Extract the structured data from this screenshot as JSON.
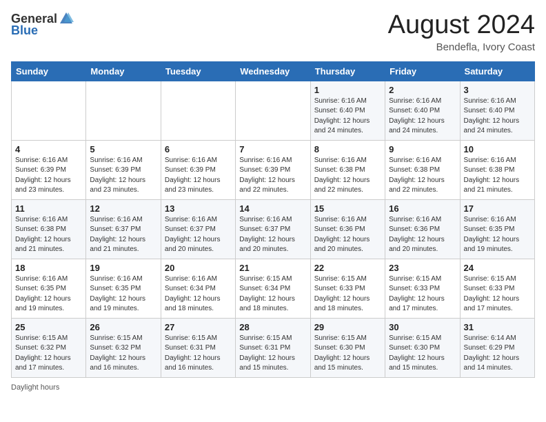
{
  "header": {
    "logo_general": "General",
    "logo_blue": "Blue",
    "month_title": "August 2024",
    "location": "Bendefla, Ivory Coast"
  },
  "footer": {
    "daylight_label": "Daylight hours"
  },
  "days_of_week": [
    "Sunday",
    "Monday",
    "Tuesday",
    "Wednesday",
    "Thursday",
    "Friday",
    "Saturday"
  ],
  "weeks": [
    {
      "days": [
        {
          "num": "",
          "detail": ""
        },
        {
          "num": "",
          "detail": ""
        },
        {
          "num": "",
          "detail": ""
        },
        {
          "num": "",
          "detail": ""
        },
        {
          "num": "1",
          "detail": "Sunrise: 6:16 AM\nSunset: 6:40 PM\nDaylight: 12 hours\nand 24 minutes."
        },
        {
          "num": "2",
          "detail": "Sunrise: 6:16 AM\nSunset: 6:40 PM\nDaylight: 12 hours\nand 24 minutes."
        },
        {
          "num": "3",
          "detail": "Sunrise: 6:16 AM\nSunset: 6:40 PM\nDaylight: 12 hours\nand 24 minutes."
        }
      ]
    },
    {
      "days": [
        {
          "num": "4",
          "detail": "Sunrise: 6:16 AM\nSunset: 6:39 PM\nDaylight: 12 hours\nand 23 minutes."
        },
        {
          "num": "5",
          "detail": "Sunrise: 6:16 AM\nSunset: 6:39 PM\nDaylight: 12 hours\nand 23 minutes."
        },
        {
          "num": "6",
          "detail": "Sunrise: 6:16 AM\nSunset: 6:39 PM\nDaylight: 12 hours\nand 23 minutes."
        },
        {
          "num": "7",
          "detail": "Sunrise: 6:16 AM\nSunset: 6:39 PM\nDaylight: 12 hours\nand 22 minutes."
        },
        {
          "num": "8",
          "detail": "Sunrise: 6:16 AM\nSunset: 6:38 PM\nDaylight: 12 hours\nand 22 minutes."
        },
        {
          "num": "9",
          "detail": "Sunrise: 6:16 AM\nSunset: 6:38 PM\nDaylight: 12 hours\nand 22 minutes."
        },
        {
          "num": "10",
          "detail": "Sunrise: 6:16 AM\nSunset: 6:38 PM\nDaylight: 12 hours\nand 21 minutes."
        }
      ]
    },
    {
      "days": [
        {
          "num": "11",
          "detail": "Sunrise: 6:16 AM\nSunset: 6:38 PM\nDaylight: 12 hours\nand 21 minutes."
        },
        {
          "num": "12",
          "detail": "Sunrise: 6:16 AM\nSunset: 6:37 PM\nDaylight: 12 hours\nand 21 minutes."
        },
        {
          "num": "13",
          "detail": "Sunrise: 6:16 AM\nSunset: 6:37 PM\nDaylight: 12 hours\nand 20 minutes."
        },
        {
          "num": "14",
          "detail": "Sunrise: 6:16 AM\nSunset: 6:37 PM\nDaylight: 12 hours\nand 20 minutes."
        },
        {
          "num": "15",
          "detail": "Sunrise: 6:16 AM\nSunset: 6:36 PM\nDaylight: 12 hours\nand 20 minutes."
        },
        {
          "num": "16",
          "detail": "Sunrise: 6:16 AM\nSunset: 6:36 PM\nDaylight: 12 hours\nand 20 minutes."
        },
        {
          "num": "17",
          "detail": "Sunrise: 6:16 AM\nSunset: 6:35 PM\nDaylight: 12 hours\nand 19 minutes."
        }
      ]
    },
    {
      "days": [
        {
          "num": "18",
          "detail": "Sunrise: 6:16 AM\nSunset: 6:35 PM\nDaylight: 12 hours\nand 19 minutes."
        },
        {
          "num": "19",
          "detail": "Sunrise: 6:16 AM\nSunset: 6:35 PM\nDaylight: 12 hours\nand 19 minutes."
        },
        {
          "num": "20",
          "detail": "Sunrise: 6:16 AM\nSunset: 6:34 PM\nDaylight: 12 hours\nand 18 minutes."
        },
        {
          "num": "21",
          "detail": "Sunrise: 6:15 AM\nSunset: 6:34 PM\nDaylight: 12 hours\nand 18 minutes."
        },
        {
          "num": "22",
          "detail": "Sunrise: 6:15 AM\nSunset: 6:33 PM\nDaylight: 12 hours\nand 18 minutes."
        },
        {
          "num": "23",
          "detail": "Sunrise: 6:15 AM\nSunset: 6:33 PM\nDaylight: 12 hours\nand 17 minutes."
        },
        {
          "num": "24",
          "detail": "Sunrise: 6:15 AM\nSunset: 6:33 PM\nDaylight: 12 hours\nand 17 minutes."
        }
      ]
    },
    {
      "days": [
        {
          "num": "25",
          "detail": "Sunrise: 6:15 AM\nSunset: 6:32 PM\nDaylight: 12 hours\nand 17 minutes."
        },
        {
          "num": "26",
          "detail": "Sunrise: 6:15 AM\nSunset: 6:32 PM\nDaylight: 12 hours\nand 16 minutes."
        },
        {
          "num": "27",
          "detail": "Sunrise: 6:15 AM\nSunset: 6:31 PM\nDaylight: 12 hours\nand 16 minutes."
        },
        {
          "num": "28",
          "detail": "Sunrise: 6:15 AM\nSunset: 6:31 PM\nDaylight: 12 hours\nand 15 minutes."
        },
        {
          "num": "29",
          "detail": "Sunrise: 6:15 AM\nSunset: 6:30 PM\nDaylight: 12 hours\nand 15 minutes."
        },
        {
          "num": "30",
          "detail": "Sunrise: 6:15 AM\nSunset: 6:30 PM\nDaylight: 12 hours\nand 15 minutes."
        },
        {
          "num": "31",
          "detail": "Sunrise: 6:14 AM\nSunset: 6:29 PM\nDaylight: 12 hours\nand 14 minutes."
        }
      ]
    }
  ]
}
